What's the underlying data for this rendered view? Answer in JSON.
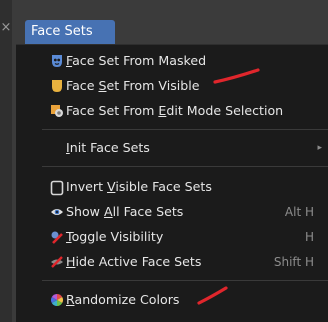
{
  "window": {
    "close_glyph": "×"
  },
  "menu": {
    "title": "Face Sets",
    "items": [
      {
        "icon": "mask-face-set-icon",
        "pre": "",
        "u": "F",
        "post": "ace Set From Masked",
        "shortcut": ""
      },
      {
        "icon": "visible-face-set-icon",
        "pre": "Face ",
        "u": "S",
        "post": "et From Visible",
        "shortcut": ""
      },
      {
        "icon": "edit-mode-face-set-icon",
        "pre": "Face Set From ",
        "u": "E",
        "post": "dit Mode Selection",
        "shortcut": ""
      },
      {
        "icon": "",
        "pre": "",
        "u": "I",
        "post": "nit Face Sets",
        "shortcut": ""
      },
      {
        "icon": "invert-visible-icon",
        "pre": "Invert ",
        "u": "V",
        "post": "isible Face Sets",
        "shortcut": ""
      },
      {
        "icon": "eye-icon",
        "pre": "Show ",
        "u": "A",
        "post": "ll Face Sets",
        "shortcut": "Alt H"
      },
      {
        "icon": "toggle-visibility-icon",
        "pre": "",
        "u": "T",
        "post": "oggle Visibility",
        "shortcut": "H"
      },
      {
        "icon": "hide-active-icon",
        "pre": "",
        "u": "H",
        "post": "ide Active Face Sets",
        "shortcut": "Shift H"
      },
      {
        "icon": "color-wheel-icon",
        "pre": "",
        "u": "R",
        "post": "andomize Colors",
        "shortcut": ""
      }
    ],
    "submenu_arrow": "▸"
  },
  "colors": {
    "header_bg": "#4772b3",
    "panel_bg": "#1b1b1b",
    "annotation": "#e0262c"
  }
}
